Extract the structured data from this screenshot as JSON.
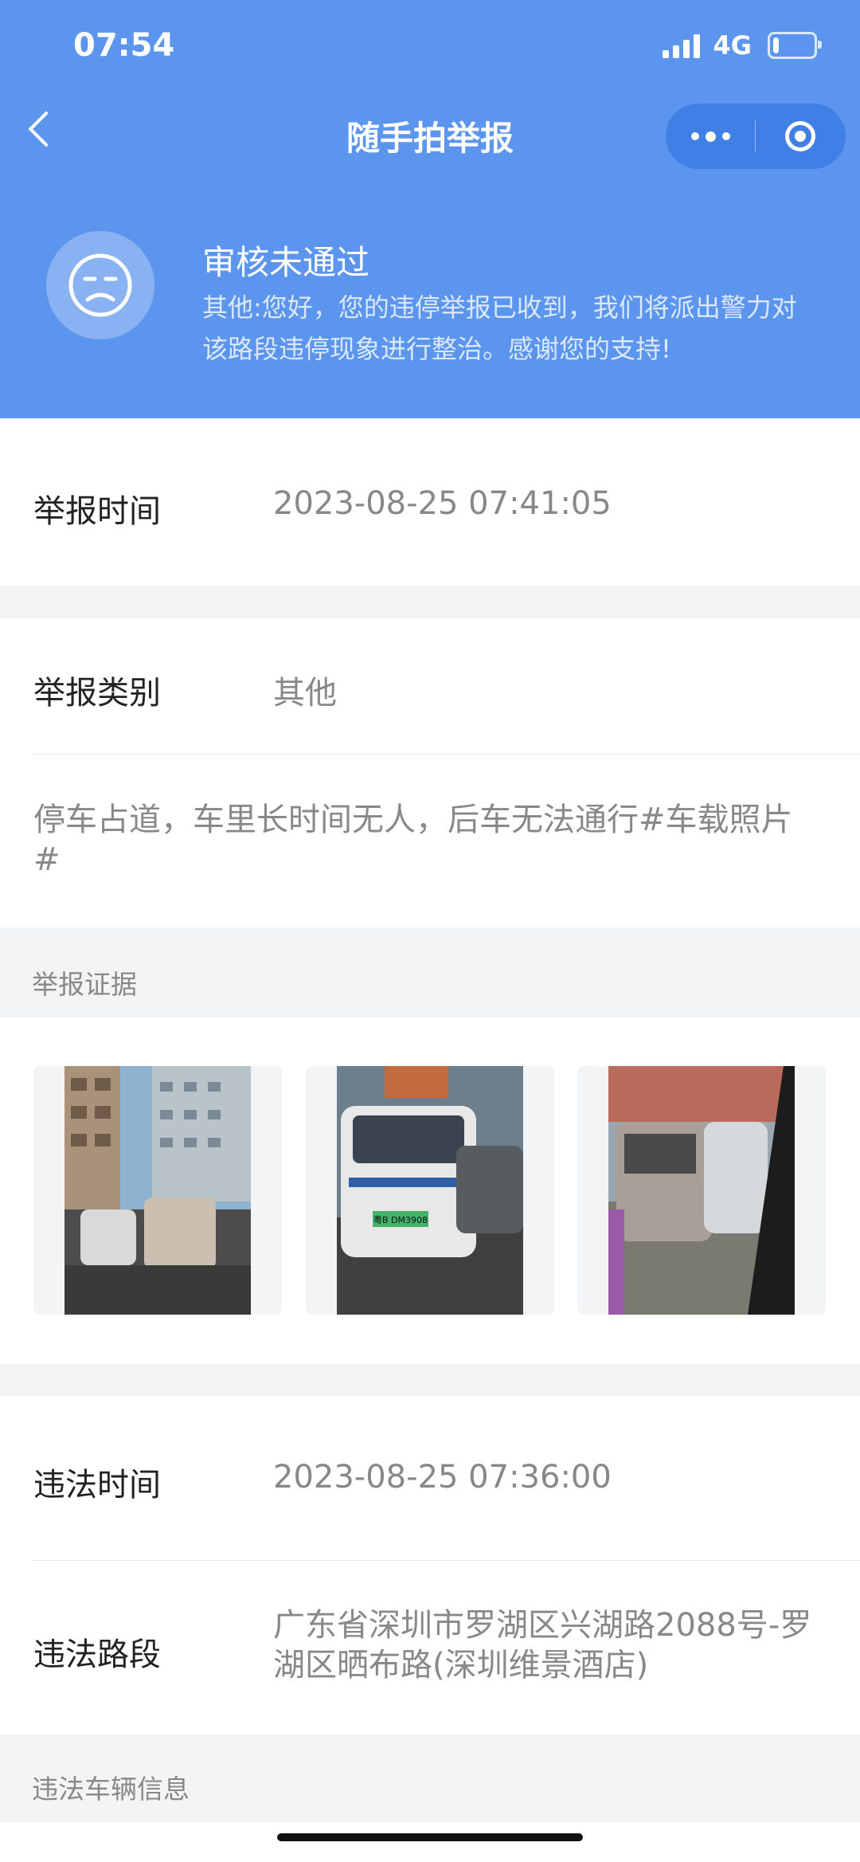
{
  "status_bar": {
    "time": "07:54",
    "network": "4G",
    "battery_percent": 15
  },
  "nav": {
    "title": "随手拍举报"
  },
  "review": {
    "status": "审核未通过",
    "message": "其他:您好，您的违停举报已收到，我们将派出警力对该路段违停现象进行整治。感谢您的支持!"
  },
  "report": {
    "time_label": "举报时间",
    "time_value": "2023-08-25 07:41:05",
    "category_label": "举报类别",
    "category_value": "其他",
    "description": "停车占道，车里长时间无人，后车无法通行#车载照片#"
  },
  "evidence": {
    "caption": "举报证据",
    "photos": [
      {
        "name": "street-view-photo"
      },
      {
        "name": "van-front-photo",
        "plate_text": "粤B DM3908"
      },
      {
        "name": "vehicles-side-photo"
      }
    ]
  },
  "violation": {
    "time_label": "违法时间",
    "time_value": "2023-08-25 07:36:00",
    "road_label": "违法路段",
    "road_value": "广东省深圳市罗湖区兴湖路2088号-罗湖区晒布路(深圳维景酒店)",
    "vehicle_caption": "违法车辆信息"
  },
  "colors": {
    "header_bg": "#5c95ee",
    "capsule_bg": "#3f7fe6"
  }
}
